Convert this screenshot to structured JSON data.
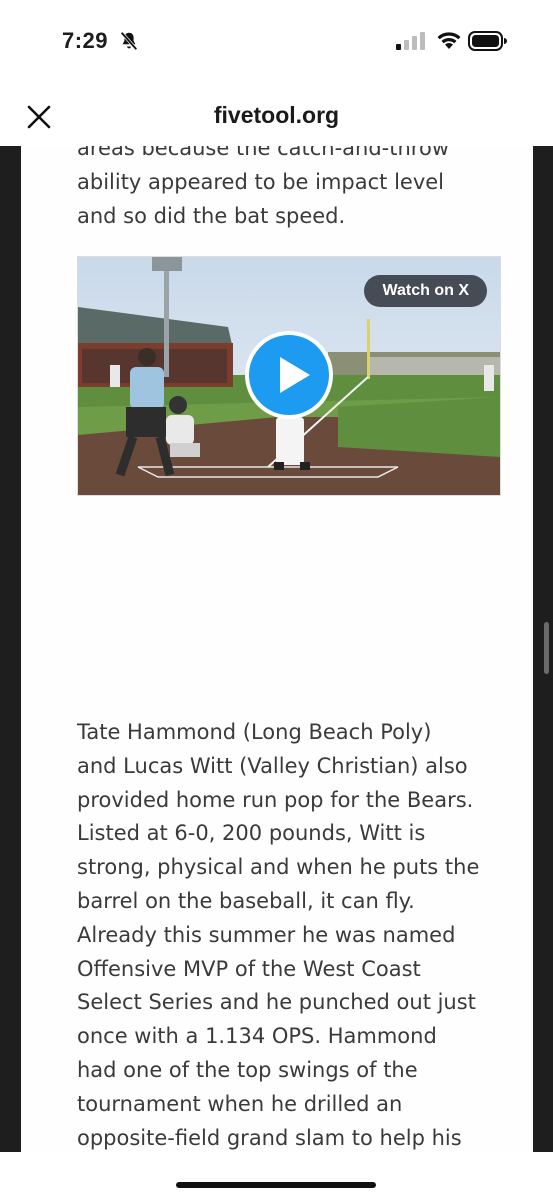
{
  "status_bar": {
    "time": "7:29",
    "icons": [
      "bell-slash-icon",
      "cellular-signal-icon",
      "wifi-icon",
      "battery-icon"
    ]
  },
  "header": {
    "close_icon": "close-icon",
    "site": "fivetool.org"
  },
  "article": {
    "para1_lines": [
      "areas because the catch-and-throw",
      "ability appeared to be impact level",
      "and so did the bat speed."
    ],
    "video": {
      "watch_label": "Watch on X",
      "play_icon": "play-icon",
      "accent": "#1d9bf0"
    },
    "para2_lines": [
      "Tate Hammond (Long Beach Poly)",
      "and Lucas Witt (Valley Christian) also",
      "provided home run pop for the Bears.",
      "Listed at 6-0, 200 pounds, Witt is",
      "strong, physical and when he puts the",
      "barrel on the baseball, it can fly.",
      "Already this summer he was named",
      "Offensive MVP of the West Coast",
      "Select Series and he punched out just",
      "once with a 1.134 OPS. Hammond",
      "had one of the top swings of the",
      "tournament when he drilled an",
      "opposite-field grand slam to help his"
    ]
  }
}
